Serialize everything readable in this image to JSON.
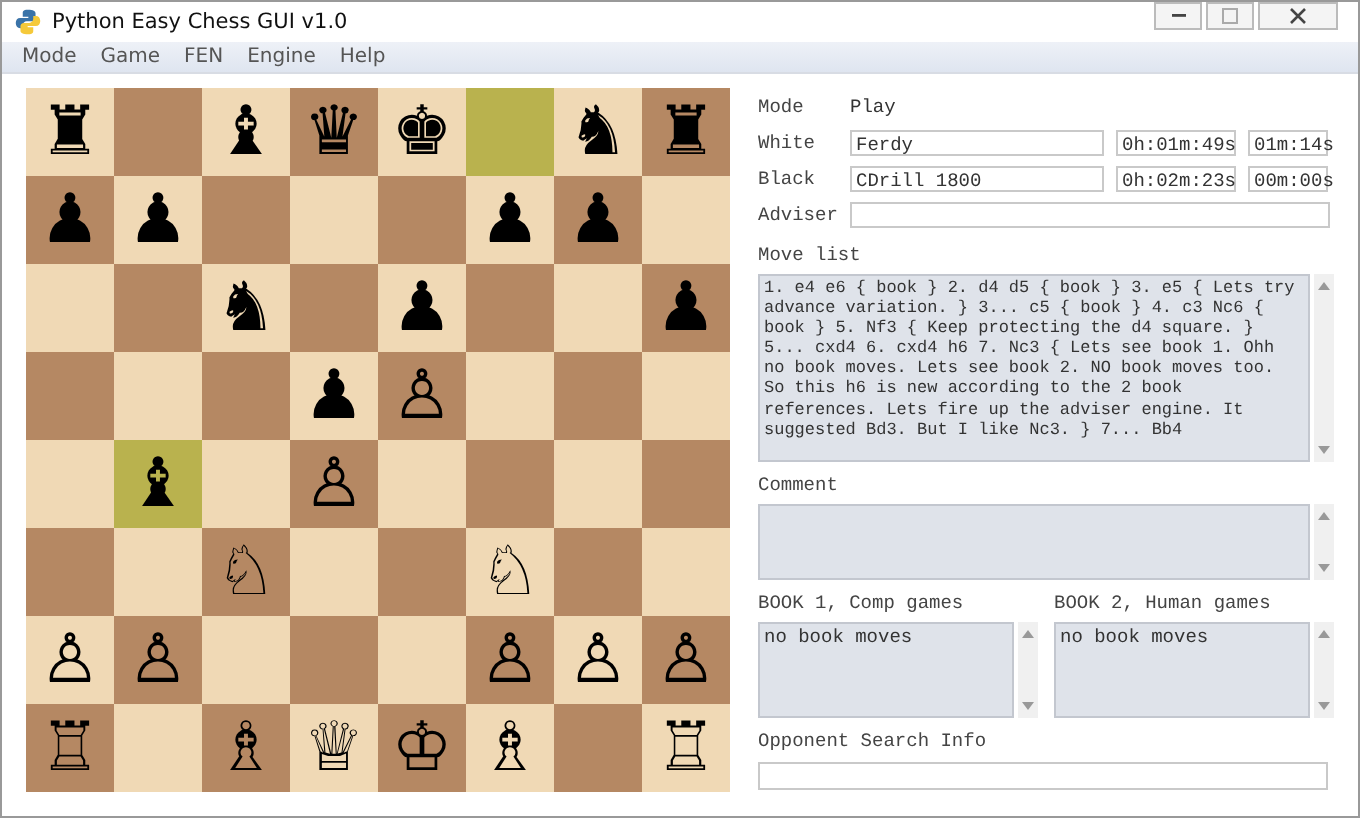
{
  "window": {
    "title": "Python Easy Chess GUI v1.0"
  },
  "menu": [
    "Mode",
    "Game",
    "FEN",
    "Engine",
    "Help"
  ],
  "board": {
    "ranks": [
      [
        {
          "piece": "♜",
          "highlighted": false
        },
        {
          "highlighted": false
        },
        {
          "piece": "♝",
          "highlighted": false
        },
        {
          "piece": "♛",
          "highlighted": false
        },
        {
          "piece": "♚",
          "highlighted": false
        },
        {
          "highlighted": true
        },
        {
          "piece": "♞",
          "highlighted": false
        },
        {
          "piece": "♜",
          "highlighted": false
        }
      ],
      [
        {
          "piece": "♟",
          "highlighted": false
        },
        {
          "piece": "♟",
          "highlighted": false
        },
        {
          "highlighted": false
        },
        {
          "highlighted": false
        },
        {
          "highlighted": false
        },
        {
          "piece": "♟",
          "highlighted": false
        },
        {
          "piece": "♟",
          "highlighted": false
        },
        {
          "highlighted": false
        }
      ],
      [
        {
          "highlighted": false
        },
        {
          "highlighted": false
        },
        {
          "piece": "♞",
          "highlighted": false
        },
        {
          "highlighted": false
        },
        {
          "piece": "♟",
          "highlighted": false
        },
        {
          "highlighted": false
        },
        {
          "highlighted": false
        },
        {
          "piece": "♟",
          "highlighted": false
        }
      ],
      [
        {
          "highlighted": false
        },
        {
          "highlighted": false
        },
        {
          "highlighted": false
        },
        {
          "piece": "♟",
          "highlighted": false
        },
        {
          "piece": "♙",
          "highlighted": false
        },
        {
          "highlighted": false
        },
        {
          "highlighted": false
        },
        {
          "highlighted": false
        }
      ],
      [
        {
          "highlighted": false
        },
        {
          "piece": "♝",
          "highlighted": true
        },
        {
          "highlighted": false
        },
        {
          "piece": "♙",
          "highlighted": false
        },
        {
          "highlighted": false
        },
        {
          "highlighted": false
        },
        {
          "highlighted": false
        },
        {
          "highlighted": false
        }
      ],
      [
        {
          "highlighted": false
        },
        {
          "highlighted": false
        },
        {
          "piece": "♘",
          "highlighted": false
        },
        {
          "highlighted": false
        },
        {
          "highlighted": false
        },
        {
          "piece": "♘",
          "highlighted": false
        },
        {
          "highlighted": false
        },
        {
          "highlighted": false
        }
      ],
      [
        {
          "piece": "♙",
          "highlighted": false
        },
        {
          "piece": "♙",
          "highlighted": false
        },
        {
          "highlighted": false
        },
        {
          "highlighted": false
        },
        {
          "highlighted": false
        },
        {
          "piece": "♙",
          "highlighted": false
        },
        {
          "piece": "♙",
          "highlighted": false
        },
        {
          "piece": "♙",
          "highlighted": false
        }
      ],
      [
        {
          "piece": "♖",
          "highlighted": false
        },
        {
          "highlighted": false
        },
        {
          "piece": "♗",
          "highlighted": false
        },
        {
          "piece": "♕",
          "highlighted": false
        },
        {
          "piece": "♔",
          "highlighted": false
        },
        {
          "piece": "♗",
          "highlighted": false
        },
        {
          "highlighted": false
        },
        {
          "piece": "♖",
          "highlighted": false
        }
      ]
    ]
  },
  "panel": {
    "mode_label": "Mode",
    "mode_value": "Play",
    "players": [
      {
        "label": "White",
        "name": "Ferdy",
        "clock": "0h:01m:49s",
        "move_time": "01m:14s"
      },
      {
        "label": "Black",
        "name": "CDrill 1800",
        "clock": "0h:02m:23s",
        "move_time": "00m:00s"
      }
    ],
    "adviser_label": "Adviser",
    "move_list_label": "Move list",
    "move_list": "1. e4 e6 { book } 2. d4 d5 { book } 3. e5 { Lets try advance variation. } 3... c5 { book } 4. c3 Nc6 { book } 5. Nf3 { Keep protecting the d4 square. } 5... cxd4 6. cxd4 h6 7. Nc3 { Lets see book 1. Ohh no book moves. Lets see book 2. NO book moves too. So this h6 is new according to the 2 book references. Lets fire up the adviser engine. It suggested Bd3. But I like Nc3. } 7... Bb4",
    "comment_label": "Comment",
    "books": [
      {
        "label": "BOOK 1, Comp games",
        "text": "no book moves"
      },
      {
        "label": "BOOK 2, Human games",
        "text": "no book moves"
      }
    ],
    "search_info_label": "Opponent Search Info"
  }
}
